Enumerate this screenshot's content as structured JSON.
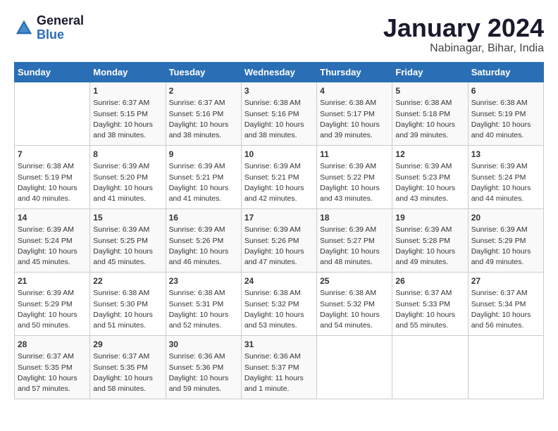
{
  "header": {
    "logo_line1": "General",
    "logo_line2": "Blue",
    "month": "January 2024",
    "location": "Nabinagar, Bihar, India"
  },
  "columns": [
    "Sunday",
    "Monday",
    "Tuesday",
    "Wednesday",
    "Thursday",
    "Friday",
    "Saturday"
  ],
  "weeks": [
    [
      {
        "day": "",
        "sunrise": "",
        "sunset": "",
        "daylight": ""
      },
      {
        "day": "1",
        "sunrise": "Sunrise: 6:37 AM",
        "sunset": "Sunset: 5:15 PM",
        "daylight": "Daylight: 10 hours and 38 minutes."
      },
      {
        "day": "2",
        "sunrise": "Sunrise: 6:37 AM",
        "sunset": "Sunset: 5:16 PM",
        "daylight": "Daylight: 10 hours and 38 minutes."
      },
      {
        "day": "3",
        "sunrise": "Sunrise: 6:38 AM",
        "sunset": "Sunset: 5:16 PM",
        "daylight": "Daylight: 10 hours and 38 minutes."
      },
      {
        "day": "4",
        "sunrise": "Sunrise: 6:38 AM",
        "sunset": "Sunset: 5:17 PM",
        "daylight": "Daylight: 10 hours and 39 minutes."
      },
      {
        "day": "5",
        "sunrise": "Sunrise: 6:38 AM",
        "sunset": "Sunset: 5:18 PM",
        "daylight": "Daylight: 10 hours and 39 minutes."
      },
      {
        "day": "6",
        "sunrise": "Sunrise: 6:38 AM",
        "sunset": "Sunset: 5:19 PM",
        "daylight": "Daylight: 10 hours and 40 minutes."
      }
    ],
    [
      {
        "day": "7",
        "sunrise": "Sunrise: 6:38 AM",
        "sunset": "Sunset: 5:19 PM",
        "daylight": "Daylight: 10 hours and 40 minutes."
      },
      {
        "day": "8",
        "sunrise": "Sunrise: 6:39 AM",
        "sunset": "Sunset: 5:20 PM",
        "daylight": "Daylight: 10 hours and 41 minutes."
      },
      {
        "day": "9",
        "sunrise": "Sunrise: 6:39 AM",
        "sunset": "Sunset: 5:21 PM",
        "daylight": "Daylight: 10 hours and 41 minutes."
      },
      {
        "day": "10",
        "sunrise": "Sunrise: 6:39 AM",
        "sunset": "Sunset: 5:21 PM",
        "daylight": "Daylight: 10 hours and 42 minutes."
      },
      {
        "day": "11",
        "sunrise": "Sunrise: 6:39 AM",
        "sunset": "Sunset: 5:22 PM",
        "daylight": "Daylight: 10 hours and 43 minutes."
      },
      {
        "day": "12",
        "sunrise": "Sunrise: 6:39 AM",
        "sunset": "Sunset: 5:23 PM",
        "daylight": "Daylight: 10 hours and 43 minutes."
      },
      {
        "day": "13",
        "sunrise": "Sunrise: 6:39 AM",
        "sunset": "Sunset: 5:24 PM",
        "daylight": "Daylight: 10 hours and 44 minutes."
      }
    ],
    [
      {
        "day": "14",
        "sunrise": "Sunrise: 6:39 AM",
        "sunset": "Sunset: 5:24 PM",
        "daylight": "Daylight: 10 hours and 45 minutes."
      },
      {
        "day": "15",
        "sunrise": "Sunrise: 6:39 AM",
        "sunset": "Sunset: 5:25 PM",
        "daylight": "Daylight: 10 hours and 45 minutes."
      },
      {
        "day": "16",
        "sunrise": "Sunrise: 6:39 AM",
        "sunset": "Sunset: 5:26 PM",
        "daylight": "Daylight: 10 hours and 46 minutes."
      },
      {
        "day": "17",
        "sunrise": "Sunrise: 6:39 AM",
        "sunset": "Sunset: 5:26 PM",
        "daylight": "Daylight: 10 hours and 47 minutes."
      },
      {
        "day": "18",
        "sunrise": "Sunrise: 6:39 AM",
        "sunset": "Sunset: 5:27 PM",
        "daylight": "Daylight: 10 hours and 48 minutes."
      },
      {
        "day": "19",
        "sunrise": "Sunrise: 6:39 AM",
        "sunset": "Sunset: 5:28 PM",
        "daylight": "Daylight: 10 hours and 49 minutes."
      },
      {
        "day": "20",
        "sunrise": "Sunrise: 6:39 AM",
        "sunset": "Sunset: 5:29 PM",
        "daylight": "Daylight: 10 hours and 49 minutes."
      }
    ],
    [
      {
        "day": "21",
        "sunrise": "Sunrise: 6:39 AM",
        "sunset": "Sunset: 5:29 PM",
        "daylight": "Daylight: 10 hours and 50 minutes."
      },
      {
        "day": "22",
        "sunrise": "Sunrise: 6:38 AM",
        "sunset": "Sunset: 5:30 PM",
        "daylight": "Daylight: 10 hours and 51 minutes."
      },
      {
        "day": "23",
        "sunrise": "Sunrise: 6:38 AM",
        "sunset": "Sunset: 5:31 PM",
        "daylight": "Daylight: 10 hours and 52 minutes."
      },
      {
        "day": "24",
        "sunrise": "Sunrise: 6:38 AM",
        "sunset": "Sunset: 5:32 PM",
        "daylight": "Daylight: 10 hours and 53 minutes."
      },
      {
        "day": "25",
        "sunrise": "Sunrise: 6:38 AM",
        "sunset": "Sunset: 5:32 PM",
        "daylight": "Daylight: 10 hours and 54 minutes."
      },
      {
        "day": "26",
        "sunrise": "Sunrise: 6:37 AM",
        "sunset": "Sunset: 5:33 PM",
        "daylight": "Daylight: 10 hours and 55 minutes."
      },
      {
        "day": "27",
        "sunrise": "Sunrise: 6:37 AM",
        "sunset": "Sunset: 5:34 PM",
        "daylight": "Daylight: 10 hours and 56 minutes."
      }
    ],
    [
      {
        "day": "28",
        "sunrise": "Sunrise: 6:37 AM",
        "sunset": "Sunset: 5:35 PM",
        "daylight": "Daylight: 10 hours and 57 minutes."
      },
      {
        "day": "29",
        "sunrise": "Sunrise: 6:37 AM",
        "sunset": "Sunset: 5:35 PM",
        "daylight": "Daylight: 10 hours and 58 minutes."
      },
      {
        "day": "30",
        "sunrise": "Sunrise: 6:36 AM",
        "sunset": "Sunset: 5:36 PM",
        "daylight": "Daylight: 10 hours and 59 minutes."
      },
      {
        "day": "31",
        "sunrise": "Sunrise: 6:36 AM",
        "sunset": "Sunset: 5:37 PM",
        "daylight": "Daylight: 11 hours and 1 minute."
      },
      {
        "day": "",
        "sunrise": "",
        "sunset": "",
        "daylight": ""
      },
      {
        "day": "",
        "sunrise": "",
        "sunset": "",
        "daylight": ""
      },
      {
        "day": "",
        "sunrise": "",
        "sunset": "",
        "daylight": ""
      }
    ]
  ]
}
